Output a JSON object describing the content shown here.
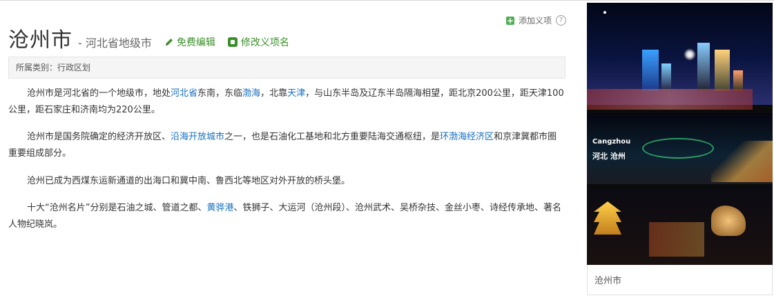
{
  "header": {
    "add_sense_label": "添加义项",
    "help_symbol": "?",
    "title": "沧州市",
    "subtitle": "- 河北省地级市",
    "edit_label": "免费编辑",
    "modify_label": "修改义项名"
  },
  "category": {
    "text": "所属类别：行政区划"
  },
  "paragraphs": {
    "p1": {
      "t1": "沧州市是河北省的一个地级市，地处",
      "l1": "河北省",
      "t2": "东南，东临",
      "l2": "渤海",
      "t3": "，北靠",
      "l3": "天津",
      "t4": "，与山东半岛及辽东半岛隔海相望，距北京200公里，距天津100公里，距石家庄和济南均为220公里。"
    },
    "p2": {
      "t1": "沧州市是国务院确定的经济开放区、",
      "l1": "沿海开放城市",
      "t2": "之一，也是石油化工基地和北方重要陆海交通枢纽，是",
      "l2": "环渤海经济区",
      "t3": "和京津冀都市圈重要组成部分。"
    },
    "p3": {
      "t1": "沧州已成为西煤东运新通道的出海口和冀中南、鲁西北等地区对外开放的桥头堡。"
    },
    "p4": {
      "t1": "十大“沧州名片”分别是石油之城、管道之都、",
      "l1": "黄骅港",
      "t2": "、铁狮子、大运河（沧州段）、沧州武术、吴桥杂技、金丝小枣、诗经传承地、著名人物纪晓岚。"
    }
  },
  "sidebar": {
    "image_text_en": "Cangzhou",
    "image_text_cn": "河北 沧州",
    "caption": "沧州市"
  },
  "colors": {
    "link": "#136ec2",
    "action_green": "#3a8f28",
    "add_icon_green": "#4caf50"
  },
  "icons": [
    "plus-icon",
    "help-icon",
    "pencil-icon",
    "edit-name-icon"
  ]
}
